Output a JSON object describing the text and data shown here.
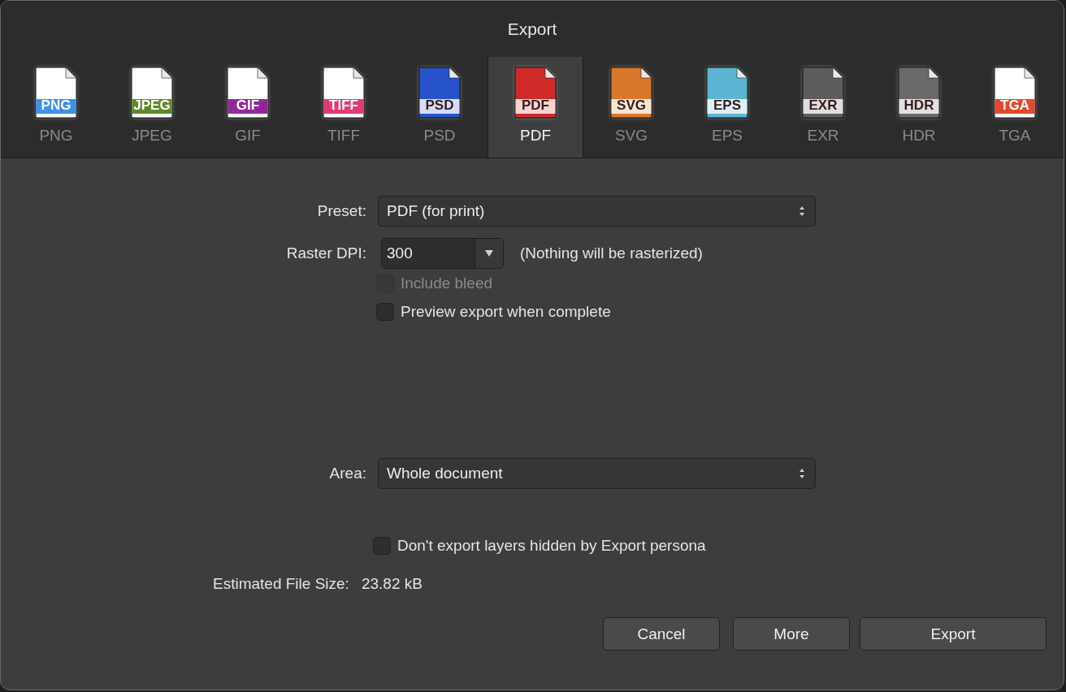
{
  "window": {
    "title": "Export"
  },
  "formats": [
    {
      "label": "PNG",
      "badge": "PNG",
      "kind": "light",
      "color": "#3d8ff0",
      "selected": false
    },
    {
      "label": "JPEG",
      "badge": "JPEG",
      "kind": "light",
      "color": "#5f8a2a",
      "selected": false
    },
    {
      "label": "GIF",
      "badge": "GIF",
      "kind": "light",
      "color": "#93279a",
      "selected": false
    },
    {
      "label": "TIFF",
      "badge": "TIFF",
      "kind": "light",
      "color": "#e23a6e",
      "selected": false
    },
    {
      "label": "PSD",
      "badge": "PSD",
      "kind": "dark",
      "color": "#2653c9",
      "selected": false
    },
    {
      "label": "PDF",
      "badge": "PDF",
      "kind": "dark",
      "color": "#cf2a2a",
      "selected": true
    },
    {
      "label": "SVG",
      "badge": "SVG",
      "kind": "dark",
      "color": "#d9782c",
      "selected": false
    },
    {
      "label": "EPS",
      "badge": "EPS",
      "kind": "dark",
      "color": "#5bb6d3",
      "selected": false
    },
    {
      "label": "EXR",
      "badge": "EXR",
      "kind": "dark",
      "color": "#5d5d5d",
      "selected": false
    },
    {
      "label": "HDR",
      "badge": "HDR",
      "kind": "dark",
      "color": "#6a6a6a",
      "selected": false
    },
    {
      "label": "TGA",
      "badge": "TGA",
      "kind": "light",
      "color": "#e5482a",
      "selected": false
    }
  ],
  "preset": {
    "label": "Preset:",
    "value": "PDF (for print)"
  },
  "raster_dpi": {
    "label": "Raster DPI:",
    "value": "300",
    "note": "(Nothing will be rasterized)"
  },
  "options": [
    {
      "label": "Include bleed",
      "checked": false,
      "disabled": true
    },
    {
      "label": "Preview export when complete",
      "checked": false,
      "disabled": false
    }
  ],
  "area": {
    "label": "Area:",
    "value": "Whole document"
  },
  "hidden_layers": {
    "label": "Don't export layers hidden by Export persona",
    "checked": false
  },
  "file_size": {
    "label": "Estimated File Size:",
    "value": "23.82 kB"
  },
  "buttons": [
    "Cancel",
    "More",
    "Export"
  ]
}
